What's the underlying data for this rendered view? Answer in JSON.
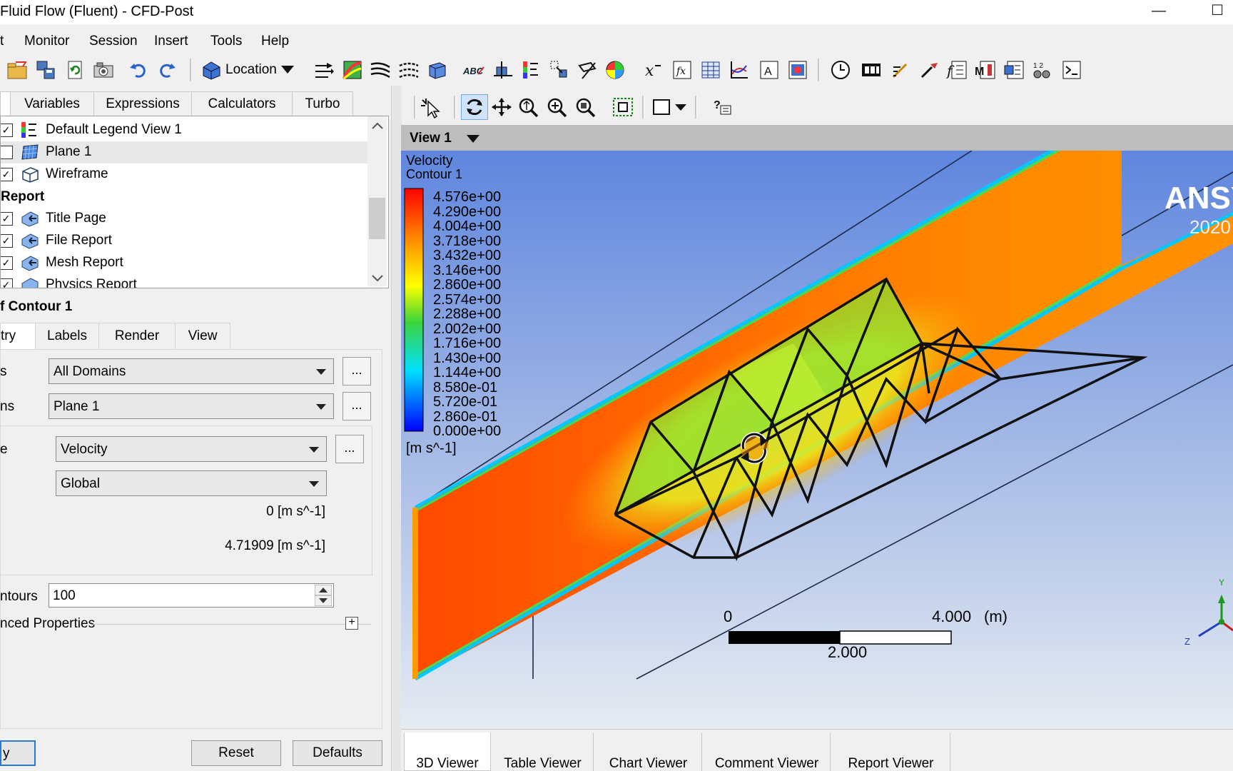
{
  "window": {
    "title": "Fluid Flow (Fluent) - CFD-Post",
    "minimize": "—",
    "maximize": "☐"
  },
  "menu": [
    "t",
    "Monitor",
    "Session",
    "Insert",
    "Tools",
    "Help"
  ],
  "toolbar": {
    "location_label": "Location"
  },
  "outline_tabs": [
    "Variables",
    "Expressions",
    "Calculators",
    "Turbo"
  ],
  "tree": {
    "items": [
      {
        "label": "Default Legend View 1",
        "checked": true
      },
      {
        "label": "Plane 1",
        "checked": false
      },
      {
        "label": "Wireframe",
        "checked": true
      }
    ],
    "report_header": "Report",
    "report_items": [
      {
        "label": "Title Page",
        "checked": true
      },
      {
        "label": "File Report",
        "checked": true
      },
      {
        "label": "Mesh Report",
        "checked": true
      },
      {
        "label": "Physics Report",
        "checked": true
      }
    ]
  },
  "details": {
    "title": "f Contour 1",
    "tabs": [
      "try",
      "Labels",
      "Render",
      "View"
    ],
    "domains_label": "s",
    "domains_value": "All Domains",
    "locations_label": "ns",
    "locations_value": "Plane 1",
    "variable_label": "e",
    "variable_value": "Velocity",
    "range_value": "Global",
    "min_value": "0 [m s^-1]",
    "max_value": "4.71909 [m s^-1]",
    "contours_label": "ntours",
    "contours_value": "100",
    "advanced_label": "nced Properties",
    "dots": "...",
    "expand": "+"
  },
  "buttons": {
    "apply": "y",
    "reset": "Reset",
    "defaults": "Defaults"
  },
  "viewer": {
    "view_title": "View 1",
    "legend_title_1": "Velocity",
    "legend_title_2": "Contour 1",
    "legend_values": [
      "4.576e+00",
      "4.290e+00",
      "4.004e+00",
      "3.718e+00",
      "3.432e+00",
      "3.146e+00",
      "2.860e+00",
      "2.574e+00",
      "2.288e+00",
      "2.002e+00",
      "1.716e+00",
      "1.430e+00",
      "1.144e+00",
      "8.580e-01",
      "5.720e-01",
      "2.860e-01",
      "0.000e+00"
    ],
    "legend_unit": "[m s^-1]",
    "brand": "ANSY",
    "brand_year": "2020",
    "scale_zero": "0",
    "scale_max": "4.000",
    "scale_unit": "(m)",
    "scale_mid": "2.000",
    "axis_y": "Y",
    "axis_z": "Z"
  },
  "bottom_tabs": [
    "3D Viewer",
    "Table Viewer",
    "Chart Viewer",
    "Comment Viewer",
    "Report Viewer"
  ],
  "colors": {
    "selection": "#e8e8e8",
    "canvas_top": "#5f86de",
    "canvas_bottom": "#e6ebf2",
    "flow_red": "#ff3d00",
    "flow_orange": "#ff8c00"
  }
}
